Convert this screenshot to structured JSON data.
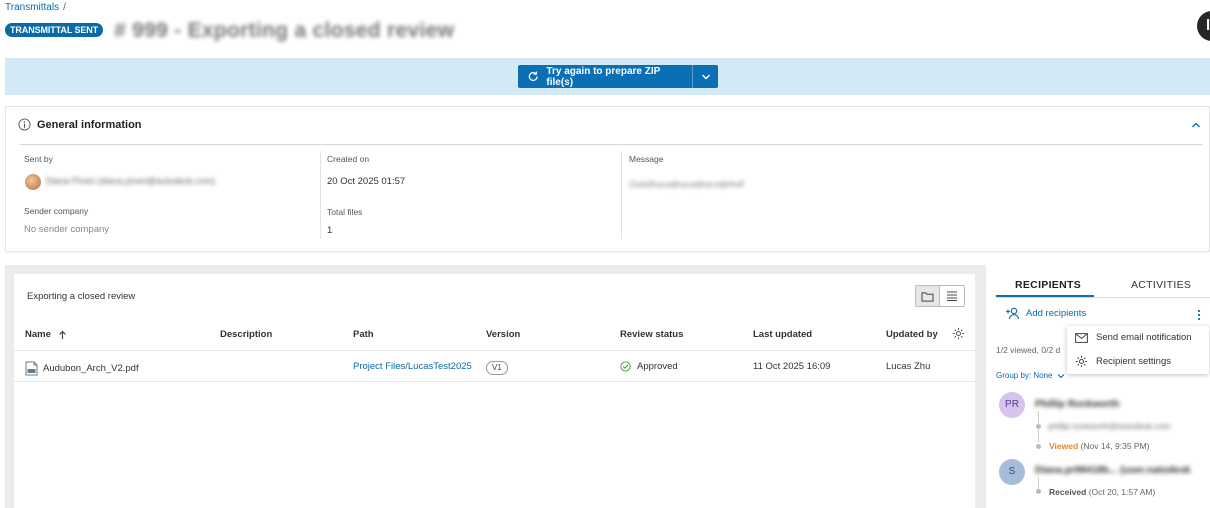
{
  "header": {
    "breadcrumb": "Transmittals",
    "breadcrumb_sep": "/",
    "status_badge": "TRANSMITTAL SENT",
    "title": "# 999 - Exporting a closed review",
    "user_avatar": "lt"
  },
  "banner": {
    "retry_button": "Try again to prepare ZIP file(s)",
    "bg_color": "#d2eaf6",
    "button_color": "#0a6fb4"
  },
  "general": {
    "title": "General information",
    "sent_by_label": "Sent by",
    "sent_by_value": "Diana Pineri (diana.pineri@autodesk.com)",
    "sender_company_label": "Sender company",
    "sender_company_value": "No sender company",
    "created_on_label": "Created on",
    "created_on_value": "20 Oct 2025 01:57",
    "total_files_label": "Total files",
    "total_files_value": "1",
    "message_label": "Message",
    "message_value": "Gadsfhacsdjhacsdjhacsdjhfsdf"
  },
  "files": {
    "heading": "Exporting a closed review",
    "columns": {
      "name": "Name",
      "description": "Description",
      "path": "Path",
      "version": "Version",
      "review_status": "Review status",
      "last_updated": "Last updated",
      "updated_by": "Updated by"
    },
    "rows": [
      {
        "name": "Audubon_Arch_V2.pdf",
        "description": "",
        "path": "Project Files/LucasTest2025",
        "version": "V1",
        "review_status": "Approved",
        "last_updated": "11 Oct 2025 16:09",
        "updated_by": "Lucas Zhu"
      }
    ]
  },
  "recipients": {
    "tab_recipients": "RECIPIENTS",
    "tab_activities": "ACTIVITIES",
    "add_label": "Add recipients",
    "summary": "1/2 viewed, 0/2 d",
    "group_by": "Group by: None",
    "menu": {
      "send_email": "Send email notification",
      "settings": "Recipient settings"
    },
    "list": [
      {
        "initials": "PR",
        "name": "Phillip Rockworth",
        "email": "phillip.rockworth@autodesk.com",
        "status": "Viewed",
        "status_time": "(Nov 14, 9:35 PM)",
        "avatar_color": "#d8c2f0",
        "status_color": "#e8872b"
      },
      {
        "initials": "S",
        "name": "Diana.pr98418b... (user.natodesk",
        "email": "",
        "status": "Received",
        "status_time": "(Oct 20, 1:57 AM)",
        "avatar_color": "#a6bcd8",
        "status_color": "#555555"
      }
    ]
  }
}
